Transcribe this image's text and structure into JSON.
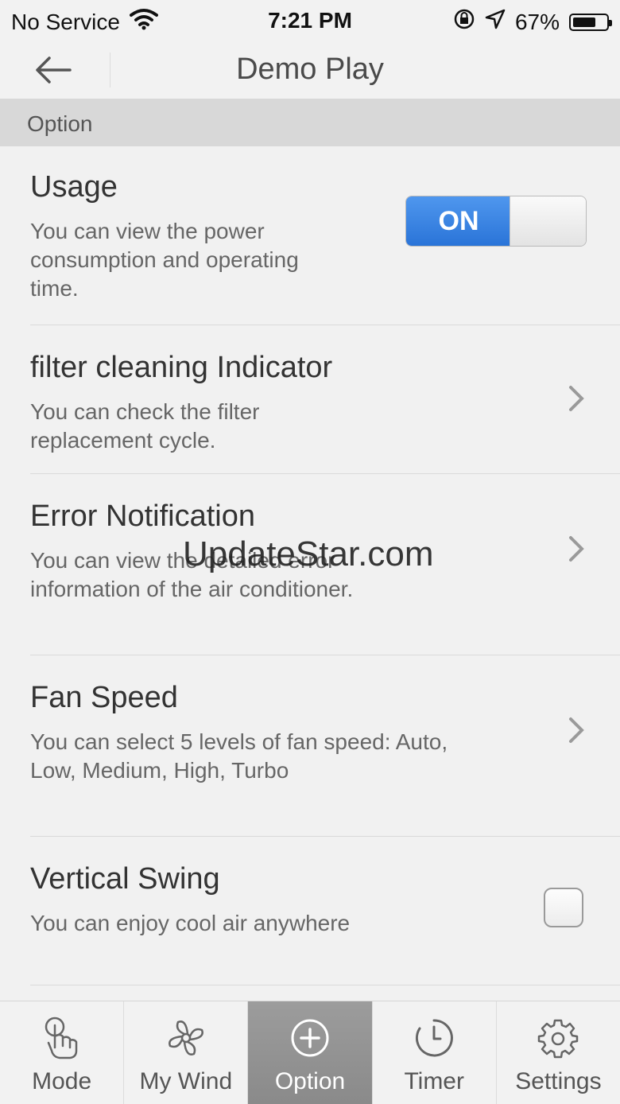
{
  "status_bar": {
    "carrier": "No Service",
    "time": "7:21 PM",
    "battery": "67%"
  },
  "nav": {
    "title": "Demo Play"
  },
  "section": {
    "label": "Option"
  },
  "items": [
    {
      "title": "Usage",
      "desc": "You can view the power consumption and operating time.",
      "toggle_label": "ON"
    },
    {
      "title": "filter cleaning Indicator",
      "desc": "You can check the filter replacement cycle."
    },
    {
      "title": "Error Notification",
      "desc": "You can view the detailed error information of the air conditioner."
    },
    {
      "title": "Fan Speed",
      "desc": "You can select 5 levels of fan speed: Auto, Low, Medium, High, Turbo"
    },
    {
      "title": "Vertical Swing",
      "desc": "You can enjoy cool air anywhere"
    }
  ],
  "watermark": "UpdateStar.com",
  "tabs": [
    {
      "label": "Mode",
      "icon": "touch-icon"
    },
    {
      "label": "My Wind",
      "icon": "fan-icon"
    },
    {
      "label": "Option",
      "icon": "plus-circle-icon"
    },
    {
      "label": "Timer",
      "icon": "timer-icon"
    },
    {
      "label": "Settings",
      "icon": "gear-icon"
    }
  ],
  "colors": {
    "accent": "#2a74d8",
    "active_tab": "#8f8f8f"
  }
}
